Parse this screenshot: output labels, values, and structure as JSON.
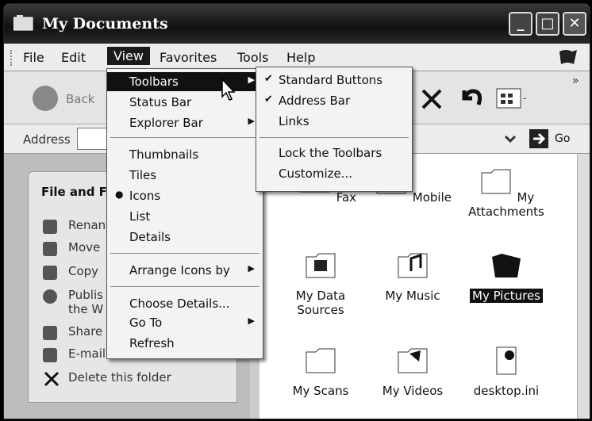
{
  "window": {
    "title": "My Documents"
  },
  "menubar": [
    "File",
    "Edit",
    "View",
    "Favorites",
    "Tools",
    "Help"
  ],
  "toolbar": {
    "back_label": "Back"
  },
  "address": {
    "label": "Address",
    "go_label": "Go"
  },
  "view_menu": {
    "toolbars": "Toolbars",
    "status_bar": "Status Bar",
    "explorer_bar": "Explorer Bar",
    "thumbnails": "Thumbnails",
    "tiles": "Tiles",
    "icons": "Icons",
    "list": "List",
    "details": "Details",
    "arrange_icons": "Arrange Icons by",
    "choose_details": "Choose Details...",
    "go_to": "Go To",
    "refresh": "Refresh"
  },
  "toolbars_submenu": {
    "standard_buttons": "Standard Buttons",
    "address_bar": "Address Bar",
    "links": "Links",
    "lock": "Lock the Toolbars",
    "customize": "Customize..."
  },
  "left_pane": {
    "heading": "File and Fi",
    "items": [
      "Renan",
      "Move",
      "Copy",
      "Publis",
      "the W",
      "Share",
      "E-mail",
      "Delete this folder"
    ]
  },
  "files": [
    {
      "name": "Fax"
    },
    {
      "name": "Mobile"
    },
    {
      "name": "My Attachments",
      "line1": "My",
      "line2": "Attachments"
    },
    {
      "name": "My Data Sources",
      "line1": "My Data",
      "line2": "Sources"
    },
    {
      "name": "My Music"
    },
    {
      "name": "My Pictures"
    },
    {
      "name": "My Scans"
    },
    {
      "name": "My Videos"
    },
    {
      "name": "desktop.ini"
    }
  ]
}
